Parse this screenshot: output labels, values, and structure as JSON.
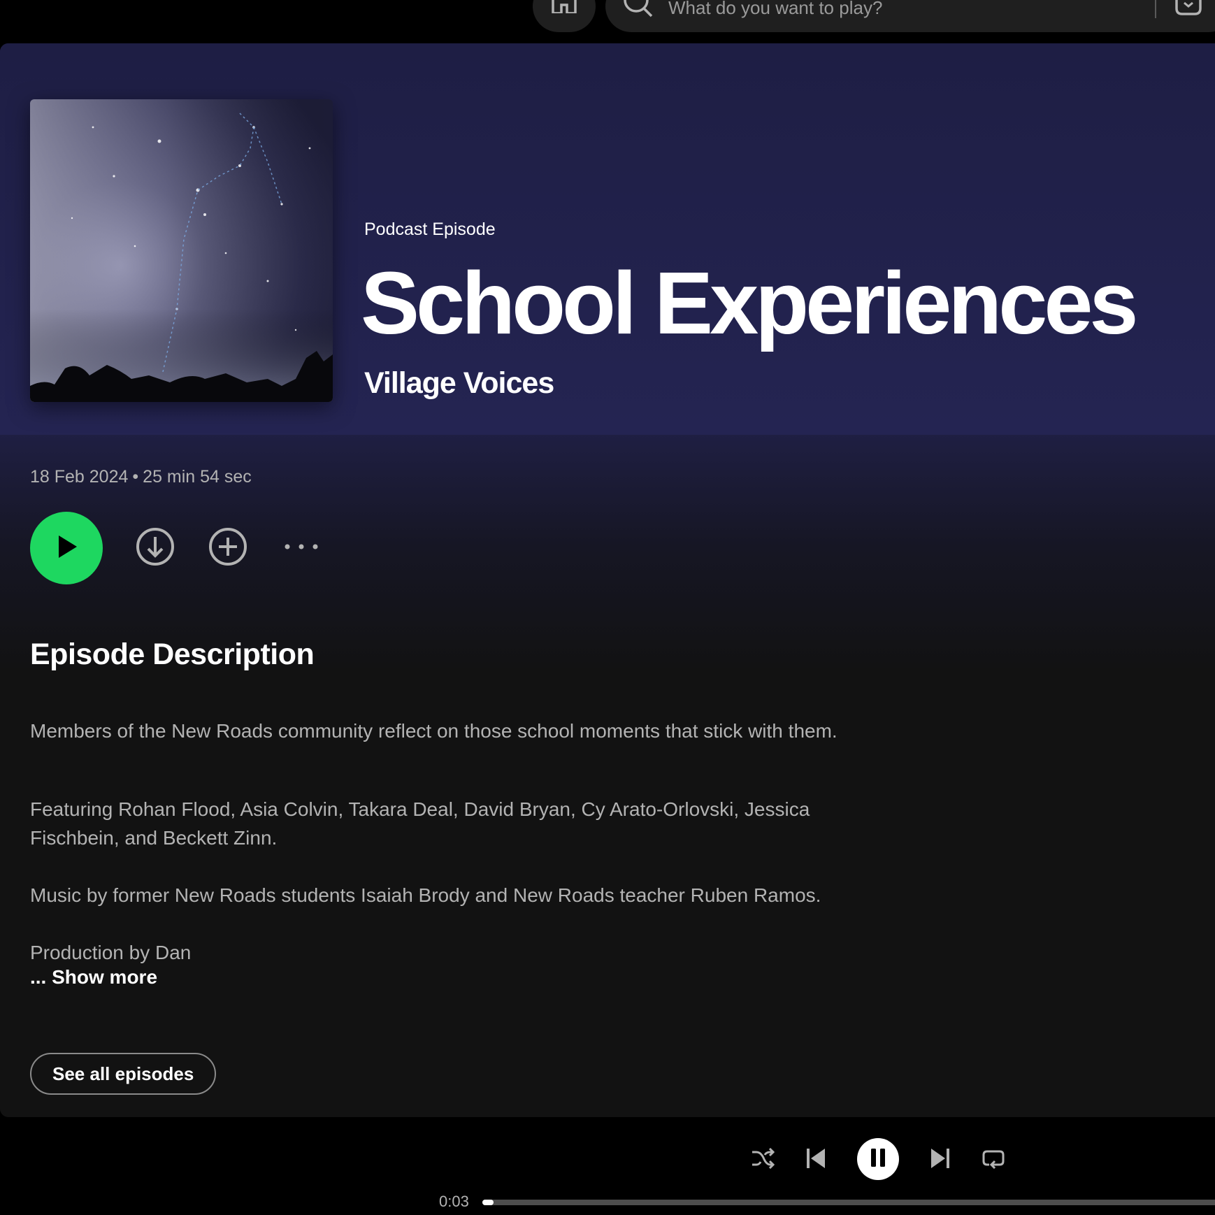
{
  "search": {
    "placeholder": "What do you want to play?"
  },
  "episode": {
    "type_label": "Podcast Episode",
    "title": "School Experiences",
    "show": "Village Voices",
    "date": "18 Feb 2024",
    "separator": "•",
    "duration": "25 min 54 sec"
  },
  "description": {
    "heading": "Episode Description",
    "paragraphs": [
      "Members of the New Roads community reflect on those school moments that stick with them.",
      "Featuring Rohan Flood, Asia Colvin, Takara Deal, David Bryan, Cy Arato-Orlovski, Jessica Fischbein, and Beckett Zinn.",
      "Music by former New Roads students Isaiah Brody and New Roads teacher Ruben Ramos.",
      "Production by Dan"
    ],
    "show_more": "... Show more"
  },
  "see_all_label": "See all episodes",
  "player": {
    "current_time": "0:03",
    "progress_fraction": 0.002
  },
  "colors": {
    "accent": "#1ed760",
    "hero_bg": "#22224c",
    "panel_bg": "#121212"
  },
  "icons": {
    "home": "home-icon",
    "search": "search-icon",
    "browse": "browse-icon",
    "play": "play-icon",
    "download": "download-icon",
    "add": "add-circle-icon",
    "more": "more-options-icon",
    "shuffle": "shuffle-icon",
    "previous": "previous-icon",
    "pause": "pause-icon",
    "next": "next-icon",
    "repeat": "repeat-icon"
  }
}
